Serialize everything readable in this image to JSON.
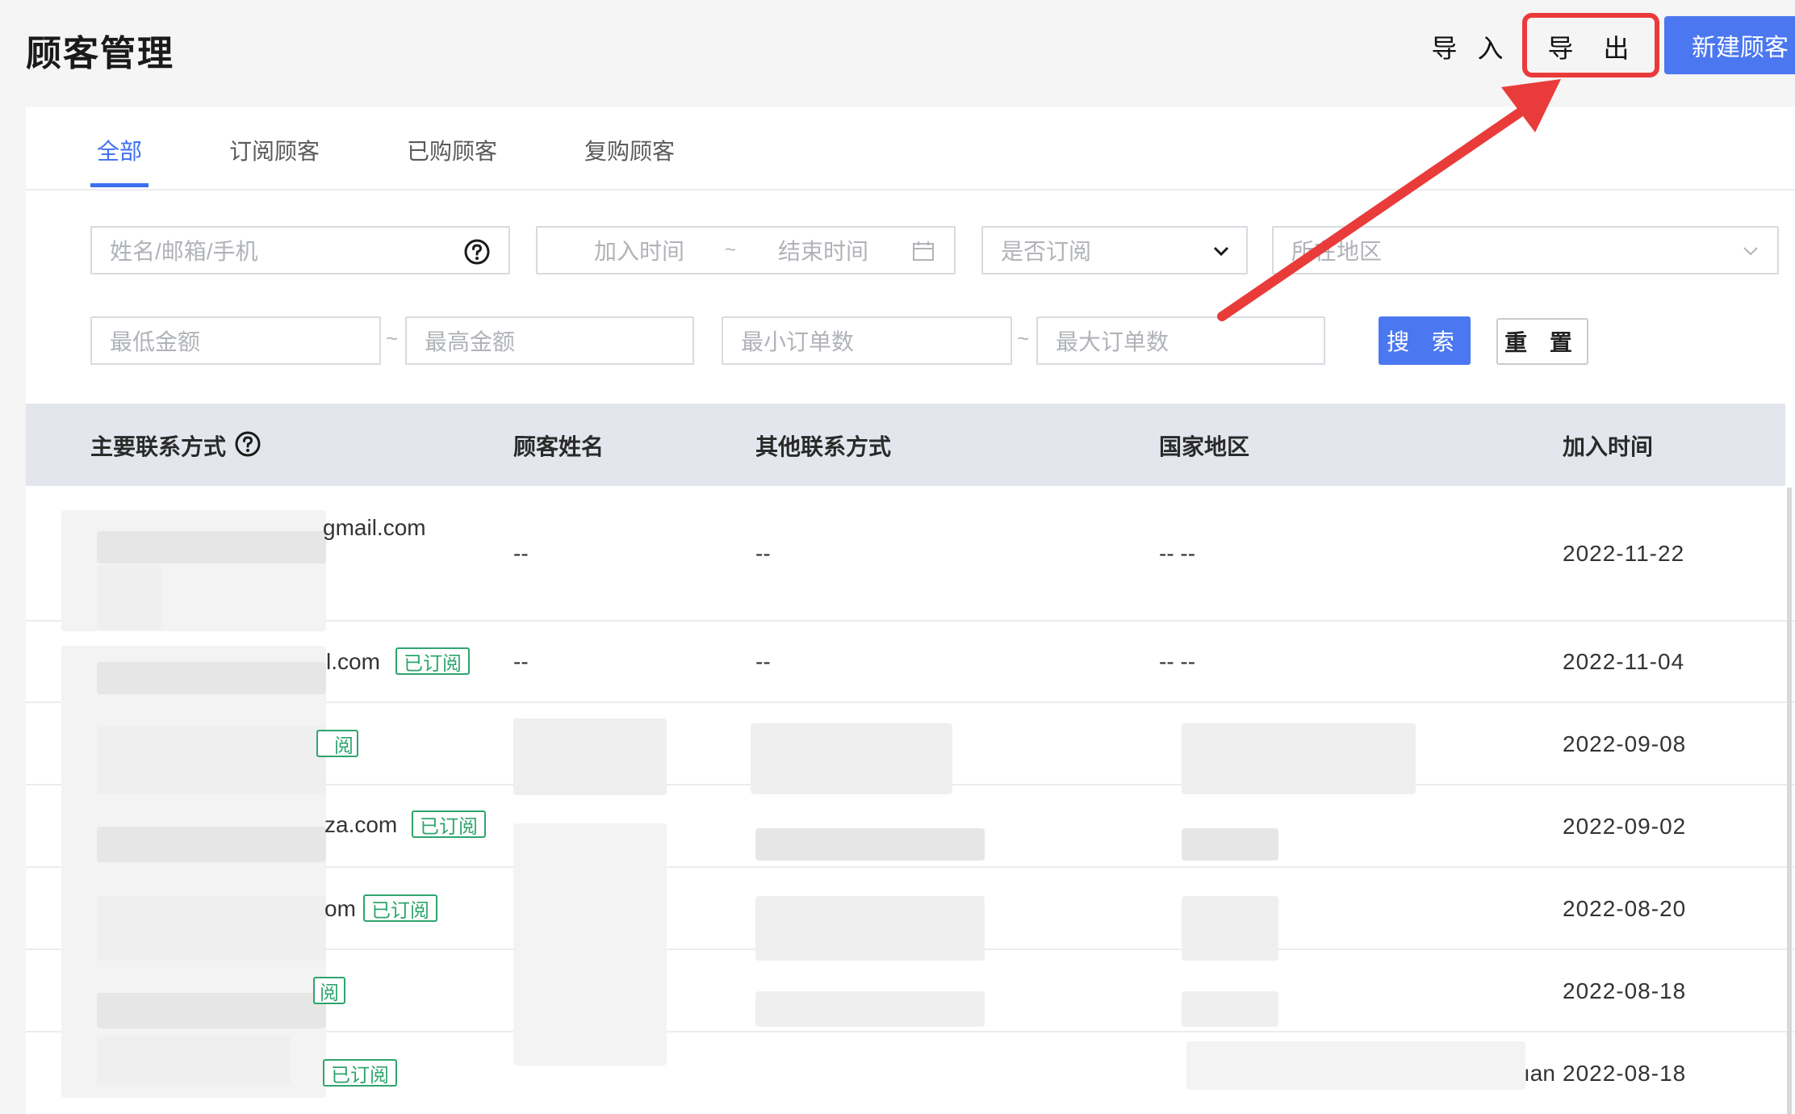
{
  "header": {
    "title": "顾客管理",
    "import_label": "导 入",
    "export_label": "导 出",
    "new_label": "新建顾客"
  },
  "tabs": [
    {
      "label": "全部",
      "active": true
    },
    {
      "label": "订阅顾客",
      "active": false
    },
    {
      "label": "已购顾客",
      "active": false
    },
    {
      "label": "复购顾客",
      "active": false
    }
  ],
  "filters": {
    "name_placeholder": "姓名/邮箱/手机",
    "start_time_placeholder": "加入时间",
    "end_time_placeholder": "结束时间",
    "range_sep": "~",
    "subscribe_placeholder": "是否订阅",
    "region_placeholder": "所在地区",
    "min_amount_placeholder": "最低金额",
    "max_amount_placeholder": "最高金额",
    "min_orders_placeholder": "最小订单数",
    "max_orders_placeholder": "最大订单数",
    "search_label": "搜 索",
    "reset_label": "重 置"
  },
  "table": {
    "columns": [
      "主要联系方式",
      "顾客姓名",
      "其他联系方式",
      "国家地区",
      "加入时间"
    ],
    "tag_label": "已订阅",
    "rows": [
      {
        "contact_suffix": "gmail.com",
        "name": "--",
        "other": "--",
        "region": "-- --",
        "date": "2022-11-22",
        "subscribed": false
      },
      {
        "contact_suffix": "l.com",
        "name": "--",
        "other": "--",
        "region": "-- --",
        "date": "2022-11-04",
        "subscribed": true
      },
      {
        "contact_suffix": "",
        "name": "",
        "other": "",
        "region": "",
        "date": "2022-09-08",
        "subscribed": true
      },
      {
        "contact_suffix": "za.com",
        "name": "",
        "other": "",
        "region": "",
        "date": "2022-09-02",
        "subscribed": true
      },
      {
        "contact_suffix": "om",
        "name": "",
        "other": "",
        "region": "",
        "date": "2022-08-20",
        "subscribed": true
      },
      {
        "contact_suffix": "",
        "name": "",
        "other": "",
        "region": "",
        "date": "2022-08-18",
        "subscribed": true
      },
      {
        "contact_suffix": "",
        "name": "",
        "other": "",
        "region": "ıan",
        "date": "2022-08-18",
        "subscribed": true
      }
    ]
  },
  "colors": {
    "primary": "#4b77f0",
    "tag_green": "#2ea56d",
    "highlight_red": "#ea3b3b"
  }
}
